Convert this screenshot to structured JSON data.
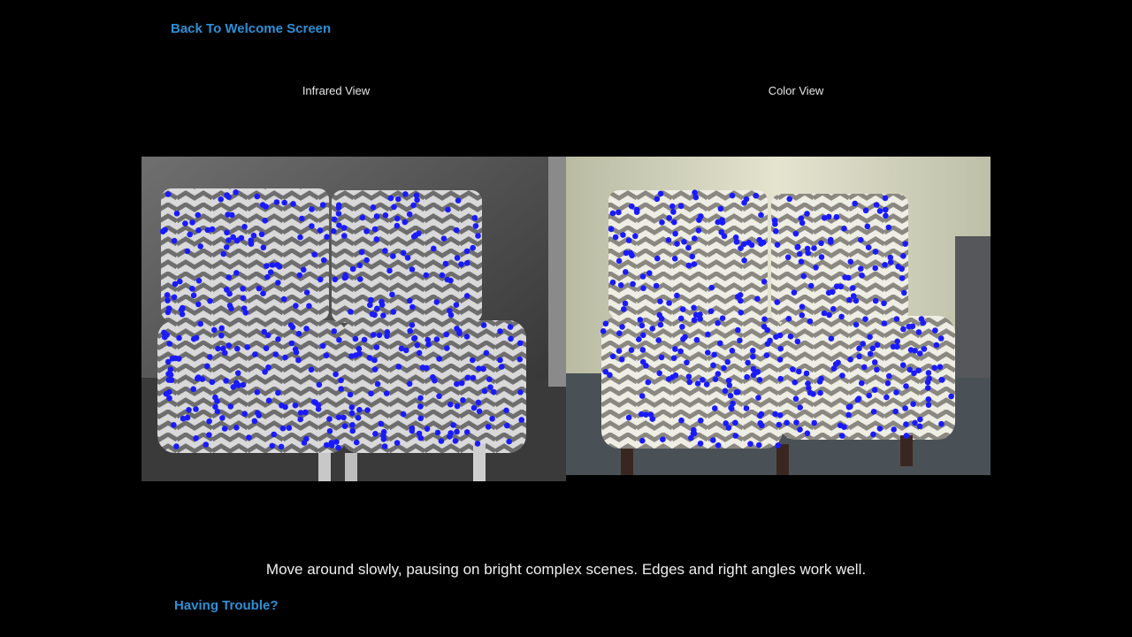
{
  "nav": {
    "back_label": "Back To Welcome Screen"
  },
  "views": {
    "infrared_label": "Infrared View",
    "color_label": "Color View"
  },
  "instructions": {
    "text": "Move around slowly, pausing on bright complex scenes. Edges and right angles work well."
  },
  "help": {
    "trouble_label": "Having Trouble?"
  },
  "colors": {
    "link": "#2e8fd6",
    "feature_point": "#1a1aff",
    "background": "#000000"
  }
}
